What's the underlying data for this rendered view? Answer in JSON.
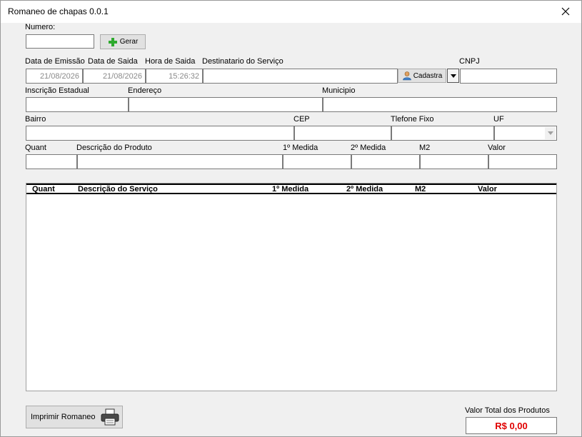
{
  "window": {
    "title": "Romaneo de chapas 0.0.1"
  },
  "header": {
    "numero_label": "Numero:",
    "numero_value": "",
    "gerar_label": "Gerar"
  },
  "row1": {
    "data_emissao_label": "Data de Emissão",
    "data_emissao_value": "21/08/2026",
    "data_saida_label": "Data de Saida",
    "data_saida_value": "21/08/2026",
    "hora_saida_label": "Hora de Saida",
    "hora_saida_value": "15:26:32",
    "destinatario_label": "Destinatario do Serviço",
    "destinatario_value": "",
    "cadastra_label": "Cadastra",
    "cnpj_label": "CNPJ",
    "cnpj_value": ""
  },
  "row2": {
    "inscricao_label": "Inscrição Estadual",
    "endereco_label": "Endereço",
    "municipio_label": "Municipio"
  },
  "row3": {
    "bairro_label": "Bairro",
    "cep_label": "CEP",
    "telefone_label": "Tlefone Fixo",
    "uf_label": "UF"
  },
  "row4": {
    "quant_label": "Quant",
    "descricao_label": "Descrição do Produto",
    "medida1_label": "1º Medida",
    "medida2_label": "2º Medida",
    "m2_label": "M2",
    "valor_label": "Valor"
  },
  "list": {
    "columns": [
      "Quant",
      "Descrição do Serviço",
      "1º Medida",
      "2º Medida",
      "M2",
      "Valor"
    ],
    "rows": []
  },
  "footer": {
    "imprimir_label": "Imprimir Romaneo",
    "total_label": "Valor Total dos Produtos",
    "total_value": "R$ 0,00"
  },
  "colors": {
    "total_text": "#e00000",
    "gerar_icon": "#2eaa2e"
  }
}
